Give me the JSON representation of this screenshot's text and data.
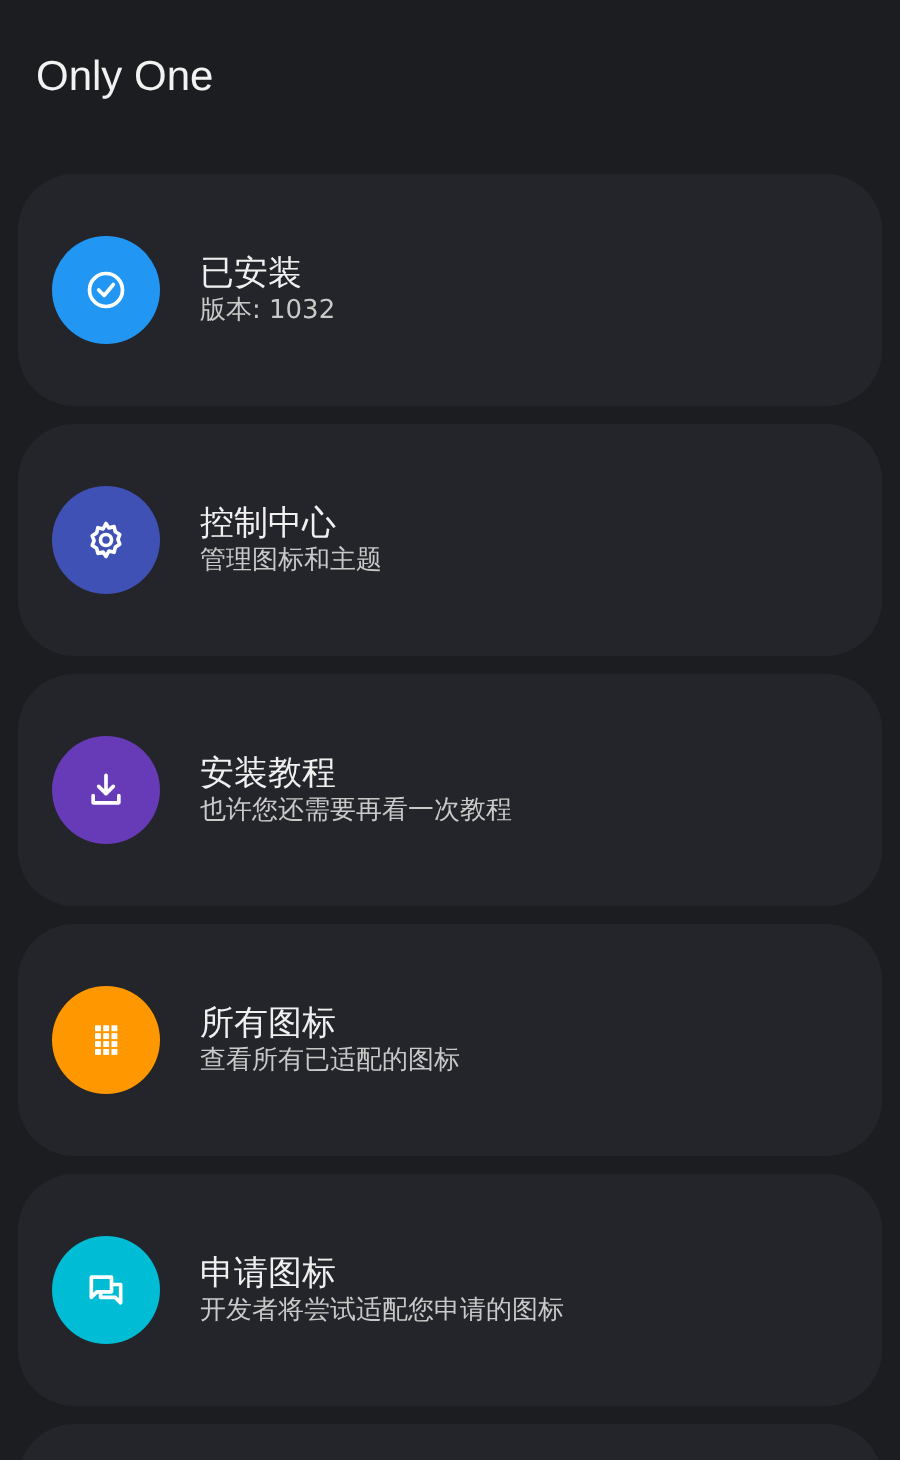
{
  "app_title": "Only One",
  "items": [
    {
      "kind": "check",
      "color": "#2196f3",
      "title": "已安装",
      "subtitle": "版本: 1032"
    },
    {
      "kind": "gear",
      "color": "#3f51b5",
      "title": "控制中心",
      "subtitle": "管理图标和主题"
    },
    {
      "kind": "download",
      "color": "#673ab7",
      "title": "安装教程",
      "subtitle": "也许您还需要再看一次教程"
    },
    {
      "kind": "grid",
      "color": "#ff9800",
      "title": "所有图标",
      "subtitle": "查看所有已适配的图标"
    },
    {
      "kind": "chat",
      "color": "#00bcd4",
      "title": "申请图标",
      "subtitle": "开发者将尝试适配您申请的图标"
    }
  ]
}
